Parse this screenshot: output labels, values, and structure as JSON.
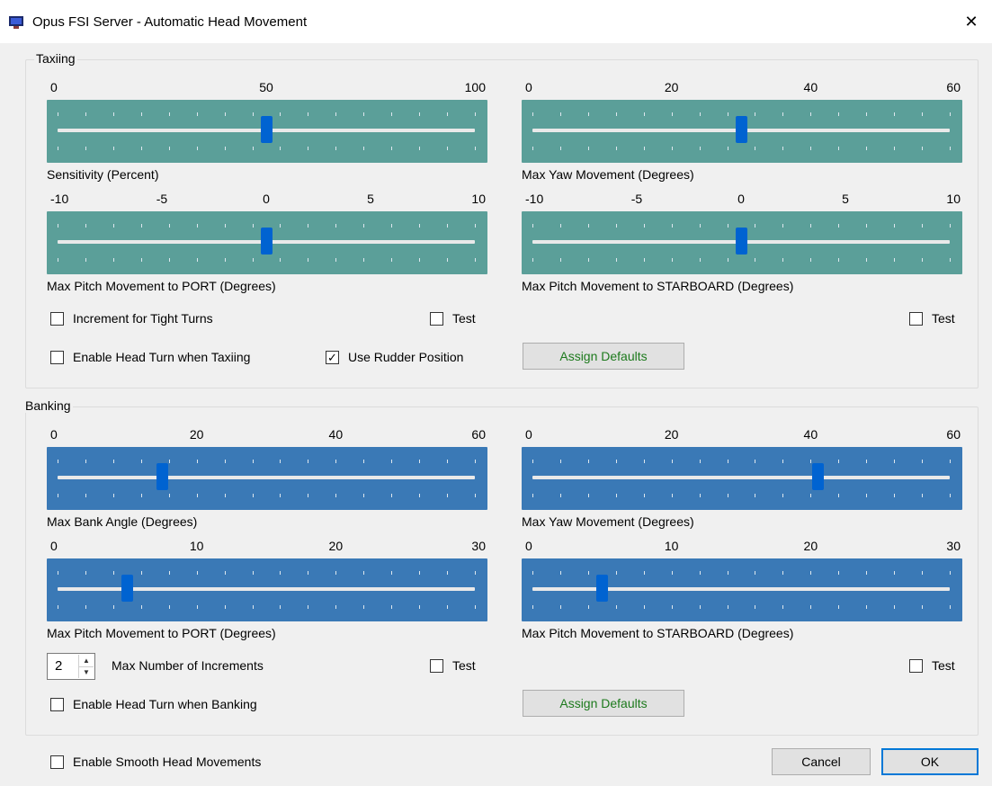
{
  "window": {
    "title": "Opus FSI Server - Automatic Head Movement",
    "close_glyph": "✕"
  },
  "taxiing": {
    "label": "Taxiing",
    "sensitivity": {
      "ticks": [
        "0",
        "50",
        "100"
      ],
      "min": 0,
      "max": 100,
      "value": 50,
      "caption": "Sensitivity (Percent)"
    },
    "max_yaw": {
      "ticks": [
        "0",
        "20",
        "40",
        "60"
      ],
      "min": 0,
      "max": 60,
      "value": 30,
      "caption": "Max Yaw Movement (Degrees)"
    },
    "pitch_port": {
      "ticks": [
        "-10",
        "-5",
        "0",
        "5",
        "10"
      ],
      "min": -10,
      "max": 10,
      "value": 0,
      "caption": "Max Pitch Movement to PORT (Degrees)"
    },
    "pitch_starboard": {
      "ticks": [
        "-10",
        "-5",
        "0",
        "5",
        "10"
      ],
      "min": -10,
      "max": 10,
      "value": 0,
      "caption": "Max Pitch Movement to STARBOARD (Degrees)"
    },
    "increment_tight_turns": {
      "label": "Increment for Tight Turns",
      "checked": false
    },
    "test_left": {
      "label": "Test",
      "checked": false
    },
    "test_right": {
      "label": "Test",
      "checked": false
    },
    "enable_head_turn": {
      "label": "Enable Head Turn when Taxiing",
      "checked": false
    },
    "use_rudder": {
      "label": "Use Rudder Position",
      "checked": true,
      "mark": "✓"
    },
    "assign_defaults": "Assign Defaults"
  },
  "banking": {
    "label": "Banking",
    "max_bank": {
      "ticks": [
        "0",
        "20",
        "40",
        "60"
      ],
      "min": 0,
      "max": 60,
      "value": 15,
      "caption": "Max Bank Angle (Degrees)"
    },
    "max_yaw": {
      "ticks": [
        "0",
        "20",
        "40",
        "60"
      ],
      "min": 0,
      "max": 60,
      "value": 41,
      "caption": "Max Yaw Movement (Degrees)"
    },
    "pitch_port": {
      "ticks": [
        "0",
        "10",
        "20",
        "30"
      ],
      "min": 0,
      "max": 30,
      "value": 5,
      "caption": "Max Pitch Movement to PORT (Degrees)"
    },
    "pitch_starboard": {
      "ticks": [
        "0",
        "10",
        "20",
        "30"
      ],
      "min": 0,
      "max": 30,
      "value": 5,
      "caption": "Max Pitch Movement to STARBOARD (Degrees)"
    },
    "max_increments": {
      "value": "2",
      "label": "Max Number of Increments"
    },
    "test_left": {
      "label": "Test",
      "checked": false
    },
    "test_right": {
      "label": "Test",
      "checked": false
    },
    "enable_head_turn": {
      "label": "Enable Head Turn when Banking",
      "checked": false
    },
    "assign_defaults": "Assign Defaults"
  },
  "footer": {
    "smooth": {
      "label": "Enable Smooth Head Movements",
      "checked": false
    },
    "cancel": "Cancel",
    "ok": "OK"
  },
  "colors": {
    "taxi_track": "#5b9f99",
    "bank_track": "#3a79b6",
    "thumb": "#0063d1",
    "defaults_text": "#1d7a1d",
    "ok_border": "#0078d7"
  }
}
